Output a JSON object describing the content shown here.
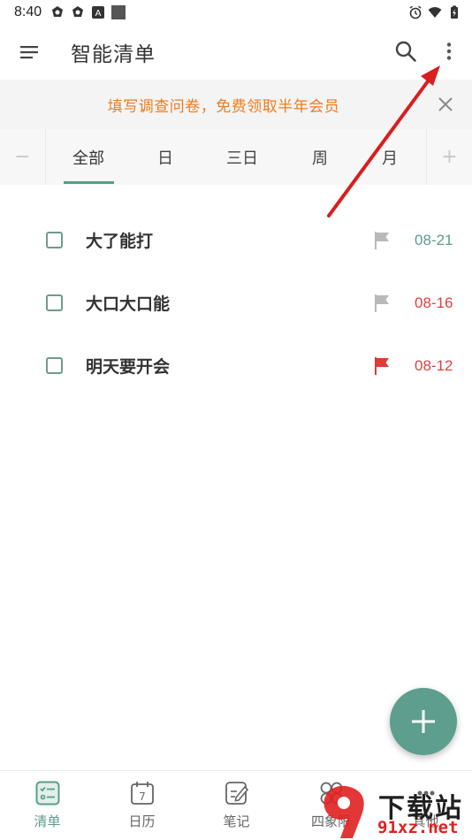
{
  "status_bar": {
    "time": "8:40"
  },
  "app_bar": {
    "title": "智能清单",
    "icons": [
      "menu-icon",
      "search-icon",
      "more-vert-icon"
    ]
  },
  "banner": {
    "text": "填写调查问卷，免费领取半年会员",
    "color": "#f07b1d"
  },
  "tabs": {
    "minus": "−",
    "plus": "+",
    "items": [
      {
        "label": "全部",
        "active": true
      },
      {
        "label": "日",
        "active": false
      },
      {
        "label": "三日",
        "active": false
      },
      {
        "label": "周",
        "active": false
      },
      {
        "label": "月",
        "active": false
      }
    ],
    "accent": "#5a9c8c"
  },
  "tasks": [
    {
      "title": "大了能打",
      "date": "08-21",
      "flag": "grey",
      "date_color": "#5a9c8c"
    },
    {
      "title": "大口大口能",
      "date": "08-16",
      "flag": "grey",
      "date_color": "#e04040"
    },
    {
      "title": "明天要开会",
      "date": "08-12",
      "flag": "red",
      "date_color": "#e04040"
    }
  ],
  "bottom_nav": {
    "items": [
      {
        "label": "清单",
        "icon": "checklist-icon",
        "active": true
      },
      {
        "label": "日历",
        "icon": "calendar-icon",
        "active": false
      },
      {
        "label": "笔记",
        "icon": "note-icon",
        "active": false
      },
      {
        "label": "四象限",
        "icon": "quadrant-icon",
        "active": false
      },
      {
        "label": "其他",
        "icon": "other-icon",
        "active": false
      }
    ]
  },
  "calendar_day": "7",
  "watermark": {
    "text": "下载站",
    "url": "91xz.net"
  }
}
